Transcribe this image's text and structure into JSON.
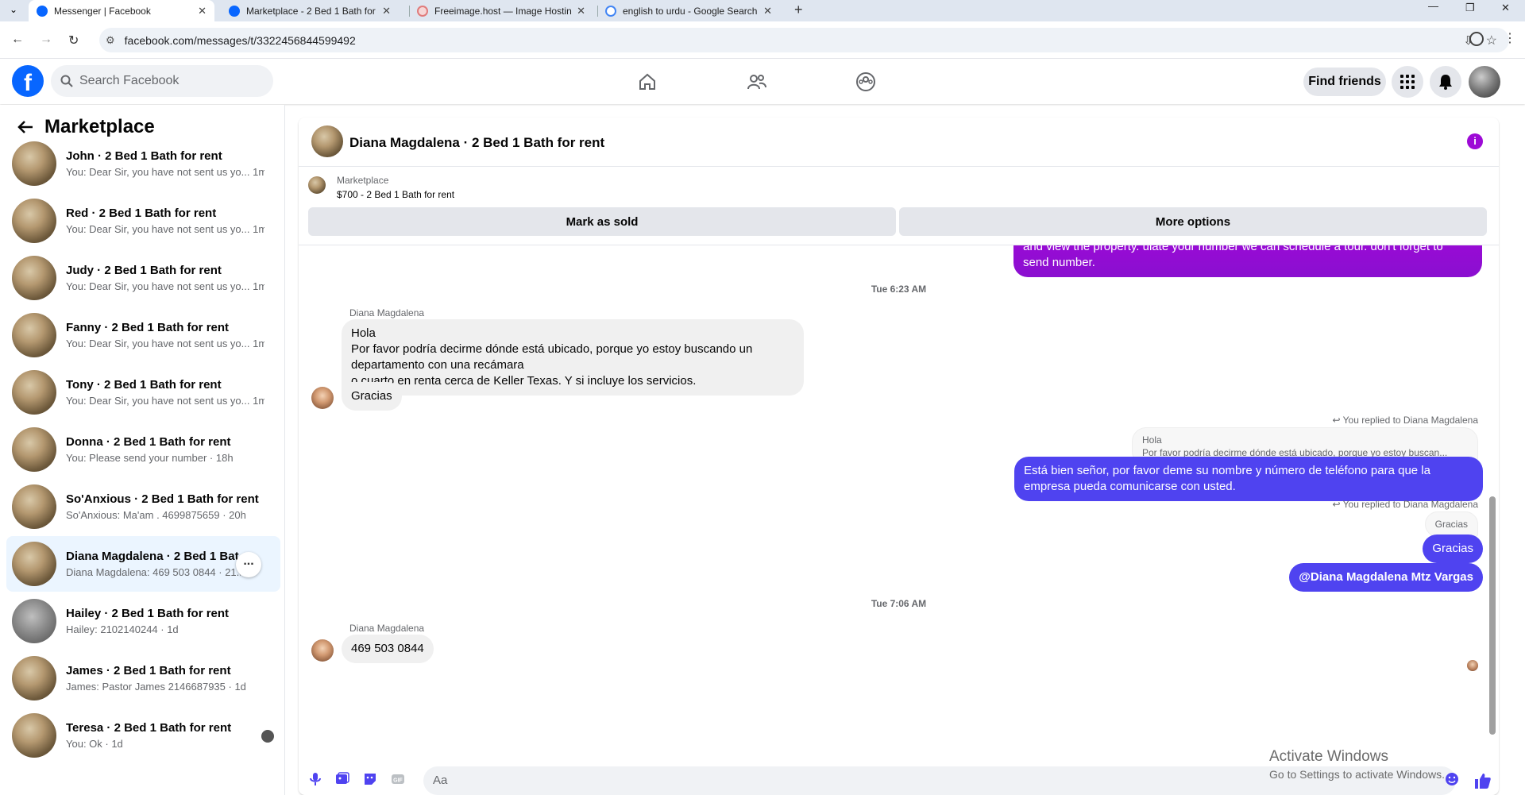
{
  "browser": {
    "tabs": [
      {
        "title": "Messenger | Facebook",
        "active": true
      },
      {
        "title": "Marketplace - 2 Bed 1 Bath for",
        "active": false
      },
      {
        "title": "Freeimage.host — Image Hostin",
        "active": false
      },
      {
        "title": "english to urdu - Google Search",
        "active": false
      }
    ],
    "new_tab": "+",
    "url": "facebook.com/messages/t/3322456844599492"
  },
  "fb": {
    "logo": "f",
    "search_placeholder": "Search Facebook",
    "find_friends": "Find friends"
  },
  "sidebar": {
    "title": "Marketplace",
    "conversations": [
      {
        "name": "John · 2 Bed 1 Bath for rent",
        "preview": "You: Dear Sir, you have not sent us yo... 1m"
      },
      {
        "name": "Red · 2 Bed 1 Bath for rent",
        "preview": "You: Dear Sir, you have not sent us yo... 1m"
      },
      {
        "name": "Judy · 2 Bed 1 Bath for rent",
        "preview": "You: Dear Sir, you have not sent us yo... 1m"
      },
      {
        "name": "Fanny · 2 Bed 1 Bath for rent",
        "preview": "You: Dear Sir, you have not sent us yo... 1m"
      },
      {
        "name": "Tony · 2 Bed 1 Bath for rent",
        "preview": "You: Dear Sir, you have not sent us yo... 1m"
      },
      {
        "name": "Donna · 2 Bed 1 Bath for rent",
        "preview": "You: Please send your number · 18h"
      },
      {
        "name": "So'Anxious · 2 Bed 1 Bath for rent",
        "preview": "So'Anxious: Ma'am . 4699875659 · 20h"
      },
      {
        "name": "Diana Magdalena · 2 Bed 1 Bat...",
        "preview": "Diana Magdalena: 469 503 0844 · 21...",
        "options": "..."
      },
      {
        "name": "Hailey · 2 Bed 1 Bath for rent",
        "preview": "Hailey: 2102140244 · 1d"
      },
      {
        "name": "James · 2 Bed 1 Bath for rent",
        "preview": "James: Pastor James 2146687935 · 1d"
      },
      {
        "name": "Teresa · 2 Bed 1 Bath for rent",
        "preview": "You: Ok · 1d"
      }
    ]
  },
  "chat": {
    "title": "Diana Magdalena · 2 Bed 1 Bath for rent",
    "info_icon": "i",
    "marketplace_label": "Marketplace",
    "listing": "$700 - 2 Bed 1 Bath for rent",
    "mark_sold": "Mark as sold",
    "more_options": "More options",
    "top_partial_line1": "and view the property. ulate your number we can schedule a tour. don't forget to",
    "top_partial_line2": "send  number.",
    "timestamp1": "Tue 6:23 AM",
    "sender1": "Diana Magdalena",
    "msg1_line1": "Hola",
    "msg1_line2": "Por favor podría decirme dónde está ubicado, porque yo estoy buscando un",
    "msg1_line3": "departamento con una recámara",
    "msg1_line4": " o cuarto en renta cerca de Keller Texas. Y si incluye los servicios.",
    "msg2": "Gracias",
    "replied1": "You replied to Diana Magdalena",
    "quote1_line1": "Hola",
    "quote1_line2": "Por favor podría decirme dónde está ubicado, porque yo estoy buscan...",
    "reply1_line1": "Está bien señor, por favor deme su nombre y número de teléfono para que la",
    "reply1_line2": "empresa pueda comunicarse con usted.",
    "replied2": "You replied to Diana Magdalena",
    "quote2": "Gracias",
    "reply2": "Gracias",
    "reply3": "@Diana Magdalena Mtz Vargas",
    "timestamp2": "Tue 7:06 AM",
    "sender2": "Diana Magdalena",
    "msg3": "469 503 0844",
    "composer_placeholder": "Aa"
  },
  "watermark": {
    "title": "Activate Windows",
    "subtitle": "Go to Settings to activate Windows."
  },
  "colors": {
    "fb_blue": "#0866ff",
    "outgoing_bubble": "#4f43f0",
    "outgoing_bubble_top": "#9d0ad6",
    "incoming_bubble": "#f0f0f0",
    "active_conversation": "#ebf5ff"
  }
}
